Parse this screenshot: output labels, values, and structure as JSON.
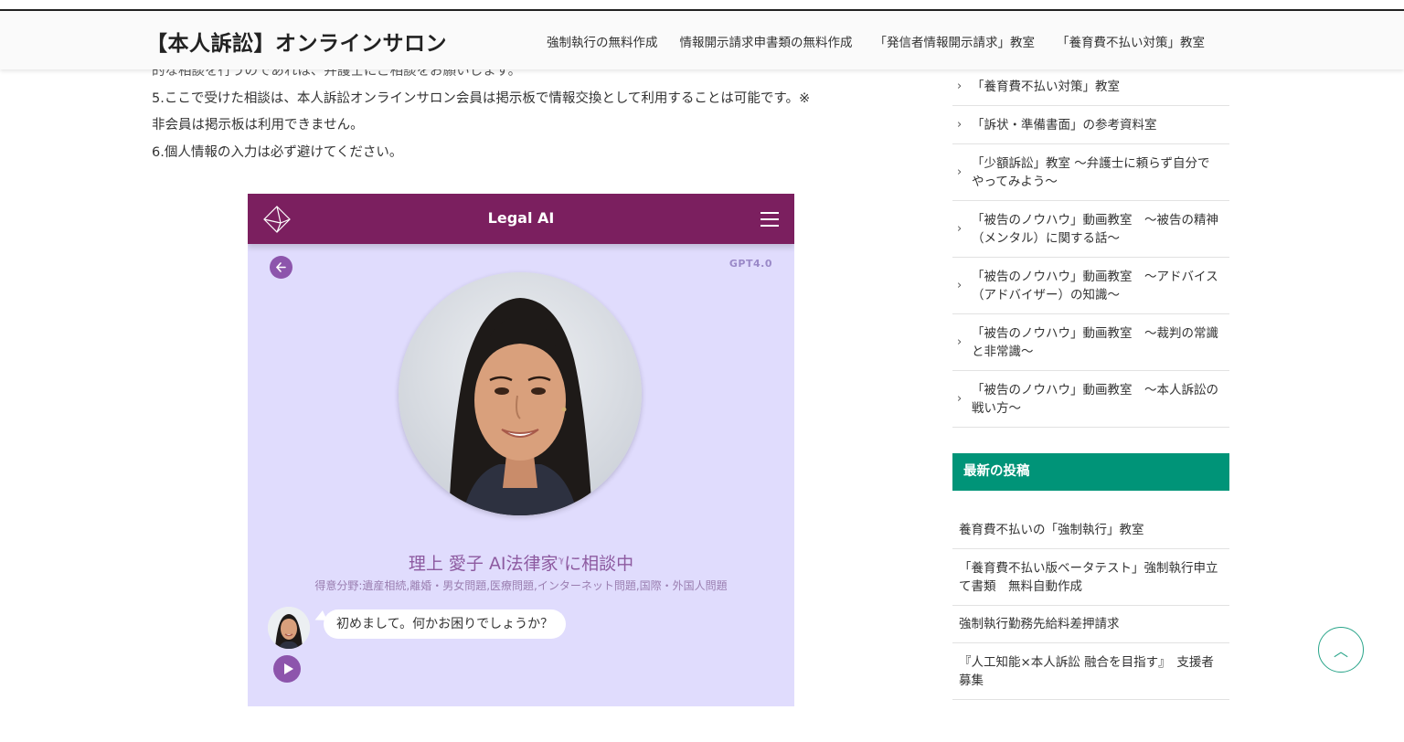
{
  "header": {
    "site_title": "【本人訴訟】オンラインサロン",
    "nav": [
      "強制執行の無料作成",
      "情報開示請求申書類の無料作成",
      "「発信者情報開示請求」教室",
      "「養育費不払い対策」教室"
    ]
  },
  "main": {
    "cut_line": "的な相談を行うのであれは、弁護士にご相談をお願いします。",
    "line5a": "5.ここで受けた相談は、本人訴訟オンラインサロン会員は掲示板で情報交換として利用することは可能です。※",
    "line5b": "非会員は掲示板は利用できません。",
    "line6": "6.個人情報の入力は必ず避けてください。"
  },
  "app": {
    "title": "Legal AI",
    "model": "GPT4.0",
    "agent_name": "理上 愛子 AI法律家",
    "agent_name_suffix": "に相談中",
    "superscript": "ℽ",
    "specialty": "得意分野:遺産相続,離婚・男女問題,医療問題,インターネット問題,国際・外国人問題",
    "greeting": "初めまして。何かお困りでしょうか？",
    "colors": {
      "header": "#7b1f5f",
      "background": "#e0dcfd",
      "accent": "#8d55ac"
    }
  },
  "sidebar": {
    "categories": [
      "「養育費不払い対策」教室",
      "「訴状・準備書面」の参考資料室",
      "「少額訴訟」教室 〜弁護士に頼らず自分でやってみよう〜",
      "「被告のノウハウ」動画教室　〜被告の精神（メンタル）に関する話〜",
      "「被告のノウハウ」動画教室　〜アドバイス（アドバイザー）の知識〜",
      "「被告のノウハウ」動画教室　〜裁判の常識と非常識〜",
      "「被告のノウハウ」動画教室　〜本人訴訟の戦い方〜"
    ],
    "recent_title": "最新の投稿",
    "recent_posts": [
      "養育費不払いの「強制執行」教室",
      "「養育費不払い版ベータテスト」強制執行申立て書類　無料自動作成",
      "強制執行勤務先給料差押請求",
      "『人工知能×本人訴訟 融合を目指す』　支援者募集"
    ],
    "accent_color": "#009478"
  },
  "scroll_top_icon": "chevron-up-icon"
}
